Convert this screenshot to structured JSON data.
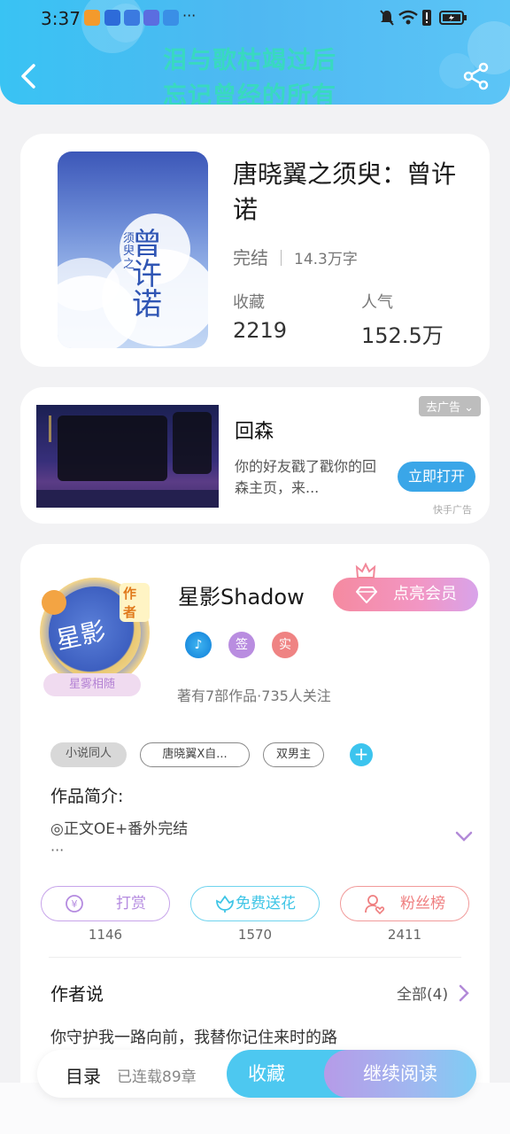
{
  "status_bar": {
    "time": "3:37",
    "more": "···",
    "icons": [
      "video-app-icon",
      "bulb-app-icon",
      "paper-plane-app-icon",
      "music-app-icon",
      "search-app-icon"
    ],
    "right_icons": [
      "mute-icon",
      "wifi-icon",
      "alert-icon",
      "battery-icon"
    ]
  },
  "header": {
    "banner_line1": "泪与歌枯竭过后",
    "banner_line2": "忘记曾经的所有",
    "gradient": [
      "#39c3f3",
      "#5cc5f6"
    ]
  },
  "book": {
    "title": "唐晓翼之须臾：曾许诺",
    "cover_title": "曾许诺",
    "cover_subtitle": "须臾之",
    "status": "完结",
    "words": "14.3万字",
    "favorites_label": "收藏",
    "favorites": "2219",
    "popularity_label": "人气",
    "popularity": "152.5万"
  },
  "ad": {
    "title": "回森",
    "description": "你的好友戳了戳你的回森主页，来...",
    "button": "立即打开",
    "close": "去广告",
    "source": "快手广告"
  },
  "author": {
    "name": "星影Shadow",
    "avatar_text": "星影",
    "avatar_badge": "作者",
    "avatar_tag": "星雾相随",
    "vip_button": "点亮会员",
    "badges": [
      "签",
      "实"
    ],
    "stats": "著有7部作品·735人关注",
    "tags": [
      "小说同人",
      "唐晓翼X自...",
      "双男主"
    ],
    "intro_label": "作品简介:",
    "intro_text": "◎正文OE+番外完结",
    "intro_more": "···"
  },
  "actions": [
    {
      "label": "打赏",
      "count": "1146",
      "color": "#b58be0"
    },
    {
      "label": "免费送花",
      "count": "1570",
      "color": "#3fc5e6"
    },
    {
      "label": "粉丝榜",
      "count": "2411",
      "color": "#ef7f80"
    }
  ],
  "author_says": {
    "title": "作者说",
    "all": "全部(4)",
    "text": "你守护我一路向前，我替你记住来时的路"
  },
  "bottom_bar": {
    "toc": "目录",
    "serial": "已连载89章",
    "favorite": "收藏",
    "continue": "继续阅读"
  }
}
